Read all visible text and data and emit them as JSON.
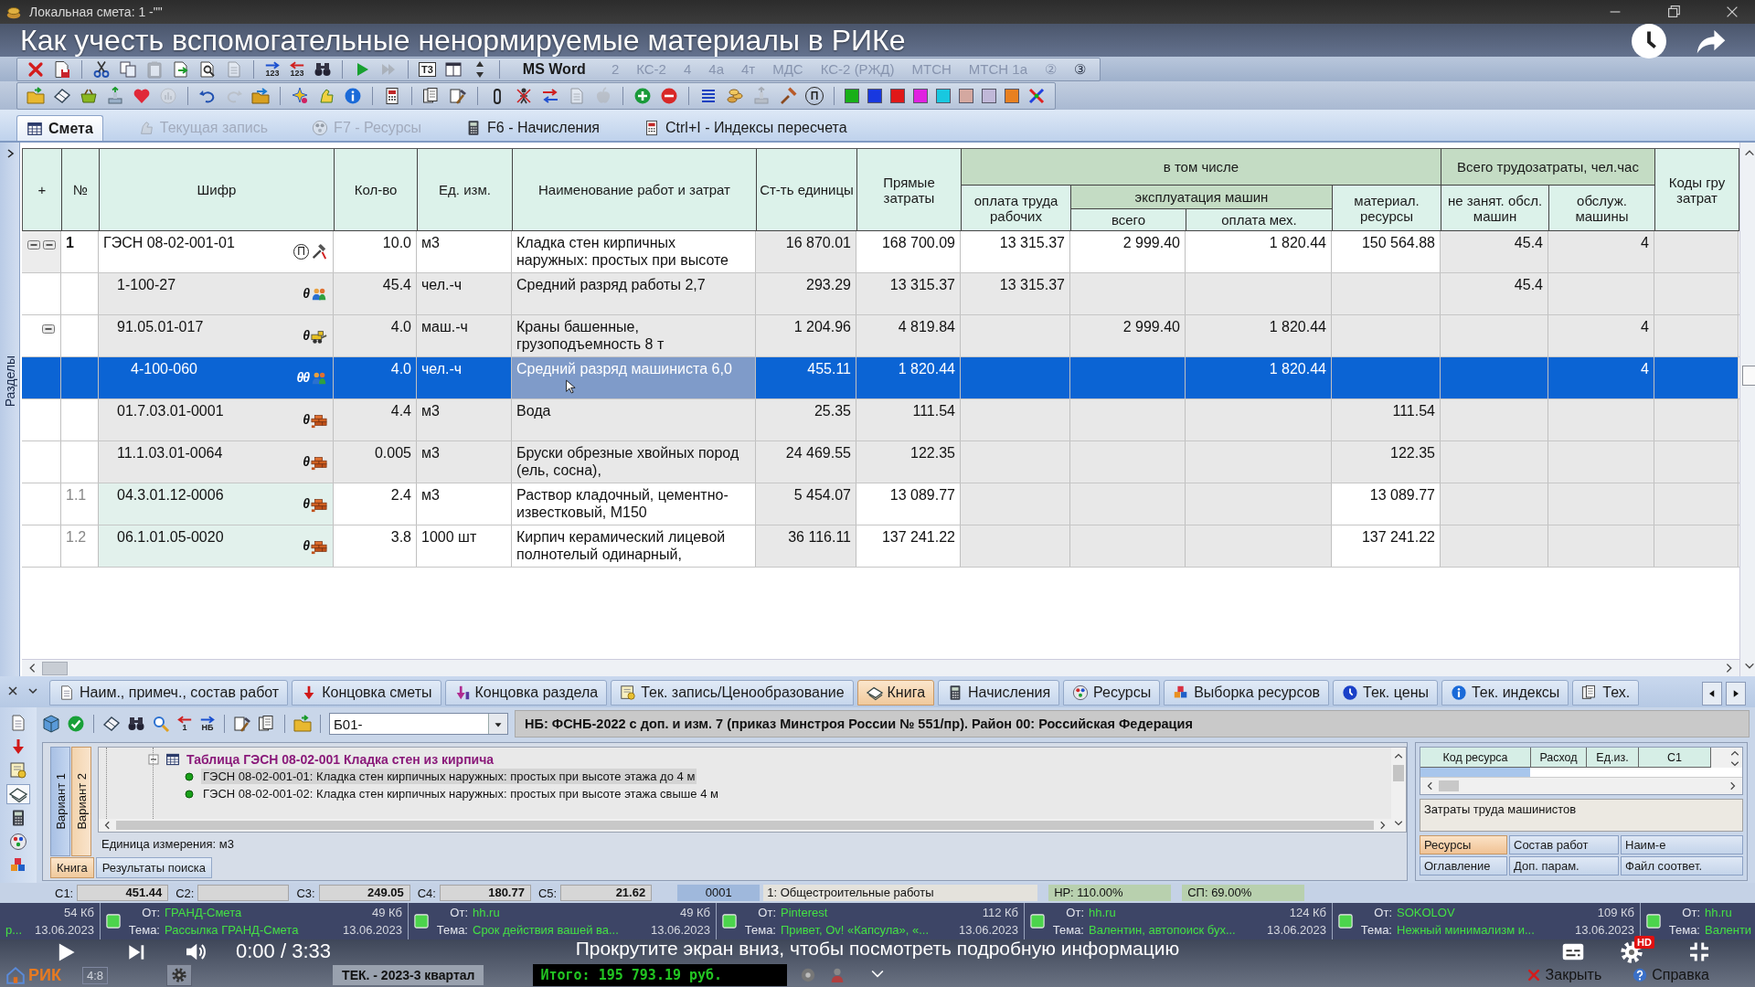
{
  "window": {
    "title": "Локальная смета: 1 -\"\""
  },
  "video": {
    "title": "Как учесть вспомогательные ненормируемые материалы в РИКе",
    "time": "0:00 / 3:33",
    "scroll_hint": "Прокрутите экран вниз, чтобы посмотреть подробную информацию",
    "quality_badge": "HD"
  },
  "toolbar_1": {
    "icons": [
      {
        "disabled": false
      },
      {
        "disabled": false
      },
      {
        "disabled": false
      },
      {
        "disabled": false
      },
      {
        "disabled": true
      },
      {
        "disabled": false
      },
      {
        "disabled": false
      },
      {
        "disabled": true
      },
      {
        "disabled": false,
        "label": "123"
      },
      {
        "disabled": false,
        "label": "123"
      },
      {
        "disabled": false
      },
      {
        "disabled": false
      },
      {
        "disabled": true
      },
      {
        "disabled": false,
        "label": "T3"
      },
      {
        "disabled": false
      },
      {
        "disabled": false
      }
    ],
    "word_button": "MS Word",
    "form_buttons": [
      {
        "label": "2",
        "disabled": true
      },
      {
        "label": "КС-2",
        "disabled": true
      },
      {
        "label": "4",
        "disabled": true
      },
      {
        "label": "4а",
        "disabled": true
      },
      {
        "label": "4т",
        "disabled": true
      },
      {
        "label": "МДС",
        "disabled": true
      },
      {
        "label": "КС-2 (РЖД)",
        "disabled": true
      },
      {
        "label": "МТСН",
        "disabled": true
      },
      {
        "label": "МТСН 1а",
        "disabled": true
      },
      {
        "label": "②",
        "disabled": true
      },
      {
        "label": "③",
        "disabled": false
      }
    ]
  },
  "toolbar_2": {
    "icons": [
      {
        "disabled": false
      },
      {
        "disabled": false
      },
      {
        "disabled": false
      },
      {
        "disabled": false
      },
      {
        "disabled": false
      },
      {
        "disabled": true
      },
      {
        "disabled": false
      },
      {
        "disabled": true
      },
      {
        "disabled": false
      },
      {
        "disabled": false
      },
      {
        "disabled": false
      },
      {
        "disabled": false
      },
      {
        "disabled": false
      },
      {
        "disabled": false
      },
      {
        "disabled": false
      },
      {
        "disabled": false
      },
      {
        "disabled": false
      },
      {
        "disabled": false
      },
      {
        "disabled": true
      },
      {
        "disabled": true
      },
      {
        "disabled": false
      },
      {
        "disabled": false
      },
      {
        "disabled": false
      },
      {
        "disabled": false
      },
      {
        "disabled": true
      },
      {
        "disabled": false
      },
      {
        "disabled": false,
        "label": "П"
      }
    ],
    "swatches": [
      {
        "color": "#18b018"
      },
      {
        "color": "#1838e0"
      },
      {
        "color": "#e01818"
      },
      {
        "color": "#e020e0"
      },
      {
        "color": "#18c8e0"
      },
      {
        "color": "#d4a8a0"
      },
      {
        "color": "#c0b8d8"
      },
      {
        "color": "#e88020"
      }
    ]
  },
  "tabs": [
    {
      "label": "Смета",
      "selected": true,
      "disabled": false
    },
    {
      "label": "Текущая запись",
      "selected": false,
      "disabled": true
    },
    {
      "label": "F7 - Ресурсы",
      "selected": false,
      "disabled": true
    },
    {
      "label": "F6 - Начисления",
      "selected": false,
      "disabled": false
    },
    {
      "label": "Ctrl+I - Индексы пересчета",
      "selected": false,
      "disabled": false
    }
  ],
  "side_panel": {
    "label": "Разделы"
  },
  "table": {
    "columns": [
      {
        "label": "+"
      },
      {
        "label": "№"
      },
      {
        "label": "Шифр"
      },
      {
        "label": "Кол-во"
      },
      {
        "label": "Ед. изм."
      },
      {
        "label": "Наименование работ и затрат"
      },
      {
        "label": "Ст-ть единицы"
      },
      {
        "label": "Прямые затраты"
      },
      {
        "label": "в том числе",
        "children": [
          {
            "label": "оплата труда рабочих"
          },
          {
            "label": "эксплуатация машин",
            "children": [
              {
                "label": "всего"
              },
              {
                "label": "оплата мех."
              }
            ]
          },
          {
            "label": "материал. ресурсы"
          }
        ]
      },
      {
        "label": "Всего трудозатраты, чел.час",
        "children": [
          {
            "label": "не занят. обсл. машин"
          },
          {
            "label": "обслуж. машины"
          }
        ]
      },
      {
        "label": "Коды гру затрат"
      }
    ],
    "rows": [
      {
        "kind": "position",
        "selected": false,
        "toggles": [
          {
            "expanded": true
          },
          {
            "expanded": true
          }
        ],
        "number": "1",
        "code": "ГЭСН 08-02-001-01",
        "badge": "П",
        "quantity": "10.0",
        "unit": "м3",
        "name": "Кладка стен кирпичных наружных: простых при высоте",
        "unit_cost": "16 870.01",
        "direct_cost": "168 700.09",
        "labor_pay": "13 315.37",
        "machine_total": "2 999.40",
        "operator_pay": "1 820.44",
        "materials": "150 564.88",
        "labor_idle": "45.4",
        "labor_operators": "4",
        "children": [
          {
            "kind": "labor",
            "selected": false,
            "code": "1-100-27",
            "mark": "θ",
            "quantity": "45.4",
            "unit": "чел.-ч",
            "name": "Средний разряд работы 2,7",
            "unit_cost": "293.29",
            "direct_cost": "13 315.37",
            "labor_pay": "13 315.37",
            "labor_idle": "45.4"
          },
          {
            "kind": "machine",
            "selected": false,
            "toggles": [
              {
                "expanded": true
              }
            ],
            "code": "91.05.01-017",
            "mark": "θ",
            "quantity": "4.0",
            "unit": "маш.-ч",
            "name": "Краны башенные, грузоподъемность 8 т",
            "unit_cost": "1 204.96",
            "direct_cost": "4 819.84",
            "machine_total": "2 999.40",
            "operator_pay": "1 820.44",
            "labor_operators": "4",
            "children": [
              {
                "kind": "operator",
                "selected": true,
                "code": "4-100-060",
                "mark": "θθ",
                "quantity": "4.0",
                "unit": "чел.-ч",
                "name": "Средний разряд машиниста 6,0",
                "unit_cost": "455.11",
                "direct_cost": "1 820.44",
                "operator_pay": "1 820.44",
                "labor_operators": "4"
              }
            ]
          },
          {
            "kind": "resource",
            "selected": false,
            "code": "01.7.03.01-0001",
            "mark": "θ",
            "quantity": "4.4",
            "unit": "м3",
            "name": "Вода",
            "unit_cost": "25.35",
            "direct_cost": "111.54",
            "materials": "111.54"
          },
          {
            "kind": "resource",
            "selected": false,
            "code": "11.1.03.01-0064",
            "mark": "θ",
            "quantity": "0.005",
            "unit": "м3",
            "name": "Бруски обрезные хвойных пород (ель, сосна),",
            "unit_cost": "24 469.55",
            "direct_cost": "122.35",
            "materials": "122.35"
          },
          {
            "kind": "material",
            "selected": false,
            "number": "1.1",
            "code": "04.3.01.12-0006",
            "mark": "θ",
            "quantity": "2.4",
            "unit": "м3",
            "name": "Раствор кладочный, цементно-известковый, М150",
            "unit_cost": "5 454.07",
            "direct_cost": "13 089.77",
            "materials": "13 089.77"
          },
          {
            "kind": "material",
            "selected": false,
            "number": "1.2",
            "code": "06.1.01.05-0020",
            "mark": "θ",
            "quantity": "3.8",
            "unit": "1000 шт",
            "name": "Кирпич керамический лицевой полнотелый одинарный,",
            "unit_cost": "36 116.11",
            "direct_cost": "137 241.22",
            "materials": "137 241.22"
          }
        ]
      }
    ]
  },
  "bottom_tabs": [
    {
      "label": "Наим., примеч., состав работ",
      "selected": false
    },
    {
      "label": "Концовка сметы",
      "selected": false
    },
    {
      "label": "Концовка раздела",
      "selected": false
    },
    {
      "label": "Тек. запись/Ценообразование",
      "selected": false
    },
    {
      "label": "Книга",
      "selected": true
    },
    {
      "label": "Начисления",
      "selected": false
    },
    {
      "label": "Ресурсы",
      "selected": false
    },
    {
      "label": "Выборка ресурсов",
      "selected": false
    },
    {
      "label": "Тек. цены",
      "selected": false
    },
    {
      "label": "Тек. индексы",
      "selected": false
    },
    {
      "label": "Тех.",
      "selected": false
    }
  ],
  "side_tools": [
    {
      "selected": false
    },
    {
      "selected": false
    },
    {
      "selected": false
    },
    {
      "selected": true
    },
    {
      "selected": false
    },
    {
      "selected": false
    },
    {
      "selected": false
    }
  ],
  "book_toolbar": {
    "buttons": [
      {
        "disabled": false
      },
      {
        "disabled": false
      },
      {
        "disabled": false
      },
      {
        "disabled": false
      },
      {
        "disabled": false
      },
      {
        "disabled": false,
        "label": "1"
      },
      {
        "disabled": false,
        "label": "НБ"
      },
      {
        "disabled": false
      },
      {
        "disabled": false
      },
      {
        "disabled": false
      }
    ],
    "collection": {
      "value": "Б01-"
    },
    "base": "НБ: ФСНБ-2022 с доп. и изм. 7 (приказ Минстроя России № 551/пр). Район 00: Российская Федерация"
  },
  "book": {
    "variants": [
      {
        "label": "Вариант 1",
        "selected": false
      },
      {
        "label": "Вариант 2",
        "selected": true
      }
    ],
    "tree": {
      "expanded": true,
      "label": "Таблица ГЭСН 08-02-001 Кладка стен из кирпича",
      "children": [
        {
          "label": "ГЭСН 08-02-001-01: Кладка стен кирпичных наружных: простых при высоте этажа до 4 м",
          "selected": true
        },
        {
          "label": "ГЭСН 08-02-001-02: Кладка стен кирпичных наружных: простых при высоте этажа свыше 4 м",
          "selected": false
        }
      ]
    },
    "unit": "Единица измерения: м3",
    "tabs": [
      {
        "label": "Книга",
        "selected": true
      },
      {
        "label": "Результаты поиска",
        "selected": false
      }
    ]
  },
  "resources_panel": {
    "columns": [
      "Код ресурса",
      "Расход",
      "Ед.из.",
      "С1"
    ],
    "rows": [
      {
        "selected": true
      }
    ],
    "description": "Затраты труда машинистов",
    "tabs": [
      {
        "label": "Ресурсы",
        "selected": true
      },
      {
        "label": "Состав работ",
        "selected": false
      },
      {
        "label": "Наим-е",
        "selected": false
      },
      {
        "label": "Оглавление",
        "selected": false
      },
      {
        "label": "Доп. парам.",
        "selected": false
      },
      {
        "label": "Файл соответ.",
        "selected": false
      }
    ]
  },
  "status_row": {
    "fields": [
      {
        "label": "С1:",
        "value": "451.44"
      },
      {
        "label": "С2:"
      },
      {
        "label": "С3:",
        "value": "249.05"
      },
      {
        "label": "С4:",
        "value": "180.77"
      },
      {
        "label": "С5:",
        "value": "21.62"
      }
    ],
    "section_code": "0001",
    "section": "1: Общестроительные работы",
    "overhead": "НР: 110.00%",
    "profit": "СП: 69.00%"
  },
  "notifications": [
    {
      "size": "54 Кб",
      "subject": "р...",
      "date": "13.06.2023"
    },
    {
      "from_label": "От:",
      "from": "ГРАНД-Смета",
      "size": "49 Кб",
      "subject_label": "Тема:",
      "subject": "Рассылка ГРАНД-Смета",
      "date": "13.06.2023"
    },
    {
      "from_label": "От:",
      "from": "hh.ru",
      "size": "49 Кб",
      "subject_label": "Тема:",
      "subject": "Срок действия вашей ва...",
      "date": "13.06.2023"
    },
    {
      "from_label": "От:",
      "from": "Pinterest",
      "size": "112 Кб",
      "subject_label": "Тема:",
      "subject": "Привет, Ov! «Капсула», «...",
      "date": "13.06.2023"
    },
    {
      "from_label": "От:",
      "from": "hh.ru",
      "size": "124 Кб",
      "subject_label": "Тема:",
      "subject": "Валентин, автопоиск бух...",
      "date": "13.06.2023"
    },
    {
      "from_label": "От:",
      "from": "SOKOLOV",
      "size": "109 Кб",
      "subject_label": "Тема:",
      "subject": "Нежный минимализм и...",
      "date": "13.06.2023"
    },
    {
      "from_label": "От:",
      "from": "hh.ru",
      "subject_label": "Тема:",
      "subject": "Валенти"
    }
  ],
  "status_bar": {
    "logo": "РИК",
    "page": "4:8",
    "period": "ТЕК. - 2023-3 квартал",
    "total": "Итого: 195 793.19 руб.",
    "close": "Закрыть",
    "help": "Справка"
  }
}
